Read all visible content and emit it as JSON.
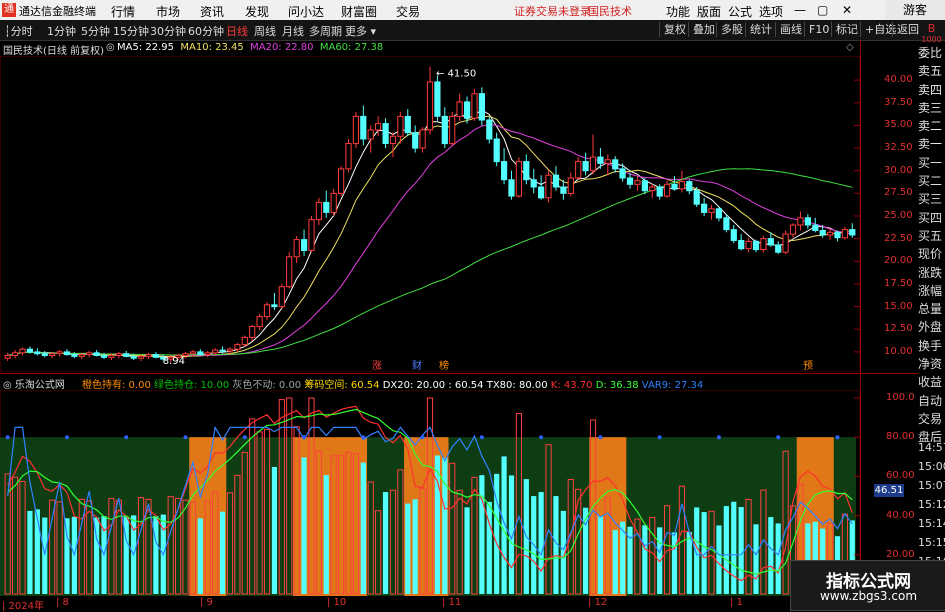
{
  "app": {
    "logo_glyph": "通",
    "name": "通达信金融终端",
    "menu": [
      "行情",
      "市场",
      "资讯",
      "发现",
      "问小达",
      "财富圈",
      "交易"
    ],
    "warning": "证券交易未登录",
    "stock_name": "国民技术",
    "right_menu": [
      "功能",
      "版面",
      "公式",
      "选项"
    ],
    "guest": "游客",
    "window_controls": [
      "—",
      "▢",
      "✕"
    ]
  },
  "toolbar": {
    "periods": [
      "分时",
      "1分钟",
      "5分钟",
      "15分钟",
      "30分钟",
      "60分钟",
      "日线",
      "周线",
      "月线",
      "多周期",
      "更多"
    ],
    "active_period": "日线",
    "buttons": [
      "复权",
      "叠加",
      "多股",
      "统计",
      "画线",
      "F10",
      "标记",
      "+自选",
      "返回"
    ]
  },
  "main_chart": {
    "title": "国民技术(日线 前复权)",
    "ma": [
      {
        "label": "MA5: 22.95",
        "color": "#ffffff"
      },
      {
        "label": "MA10: 23.45",
        "color": "#f0e060"
      },
      {
        "label": "MA20: 22.80",
        "color": "#e040e0"
      },
      {
        "label": "MA60: 27.38",
        "color": "#40e040"
      }
    ],
    "high_label": "41.50",
    "low_label": "8.94",
    "price_ticks": [
      "40.00",
      "37.50",
      "35.00",
      "32.50",
      "30.00",
      "27.50",
      "25.00",
      "22.50",
      "20.00",
      "17.50",
      "15.00",
      "12.50",
      "10.00"
    ],
    "markers": [
      {
        "text": "涨",
        "color": "#ff3030"
      },
      {
        "text": "财",
        "color": "#3060ff"
      },
      {
        "text": "榜",
        "color": "#ff8000"
      },
      {
        "text": "预",
        "color": "#ff8000"
      }
    ]
  },
  "indicator": {
    "name": "乐淘公式网",
    "params": [
      {
        "label": "橙色持有: 0.00",
        "color": "#ff8c00"
      },
      {
        "label": "绿色持仓: 10.00",
        "color": "#00c000"
      },
      {
        "label": "灰色不动: 0.00",
        "color": "#a0a0a0"
      },
      {
        "label": "筹码空间: 60.54",
        "color": "#ffd700"
      },
      {
        "label": "DX20: 20.00",
        "color": "#ffffff"
      },
      {
        "label": ": 60.54",
        "color": "#ffffff"
      },
      {
        "label": "TX80: 80.00",
        "color": "#ffffff"
      },
      {
        "label": "K: 43.70",
        "color": "#ff3030"
      },
      {
        "label": "D: 36.38",
        "color": "#30ff30"
      },
      {
        "label": "VAR9: 27.34",
        "color": "#3080ff"
      }
    ],
    "ticks": [
      "100.0",
      "80.00",
      "60.00",
      "40.00",
      "20.00"
    ],
    "current_value": "46.51"
  },
  "x_axis": {
    "labels": [
      "2024年",
      "8",
      "9",
      "10",
      "11",
      "12",
      "1"
    ]
  },
  "side_panel": {
    "items": [
      "委比",
      "卖五",
      "卖四",
      "卖三",
      "卖二",
      "卖一",
      "买一",
      "买二",
      "买三",
      "买四",
      "买五",
      "现价",
      "涨跌",
      "涨幅",
      "总量",
      "外盘",
      "换手",
      "净资",
      "收益",
      "自动",
      "交易",
      "盘后"
    ],
    "top_label": "B",
    "top_sub": "1000",
    "times": [
      "14:57",
      "15:00",
      "15:07",
      "15:12",
      "15:14",
      "15:15",
      "15:16",
      "15:17"
    ]
  },
  "watermark": {
    "line1": "指标公式网",
    "line2": "www.zbgs3.com"
  },
  "chart_data": {
    "type": "candlestick",
    "ylim": [
      8.0,
      42.0
    ],
    "ohlc": [
      [
        9.3,
        9.9,
        9.0,
        9.6
      ],
      [
        9.6,
        10.2,
        9.3,
        9.9
      ],
      [
        9.9,
        10.5,
        9.6,
        10.3
      ],
      [
        10.3,
        10.6,
        9.8,
        10.0
      ],
      [
        10.0,
        10.4,
        9.6,
        9.8
      ],
      [
        9.8,
        10.1,
        9.4,
        9.6
      ],
      [
        9.6,
        10.0,
        9.3,
        9.8
      ],
      [
        9.8,
        10.2,
        9.5,
        10.0
      ],
      [
        10.0,
        10.3,
        9.6,
        9.7
      ],
      [
        9.7,
        10.0,
        9.3,
        9.5
      ],
      [
        9.5,
        9.9,
        9.2,
        9.7
      ],
      [
        9.7,
        10.1,
        9.4,
        9.9
      ],
      [
        9.9,
        10.2,
        9.5,
        9.6
      ],
      [
        9.6,
        9.9,
        9.2,
        9.4
      ],
      [
        9.4,
        9.8,
        9.1,
        9.6
      ],
      [
        9.6,
        10.0,
        9.3,
        9.8
      ],
      [
        9.8,
        10.1,
        9.4,
        9.5
      ],
      [
        9.5,
        9.8,
        9.1,
        9.3
      ],
      [
        9.3,
        9.7,
        9.0,
        9.5
      ],
      [
        9.5,
        9.9,
        9.2,
        9.7
      ],
      [
        9.7,
        10.0,
        9.3,
        9.4
      ],
      [
        9.4,
        9.7,
        9.0,
        9.2
      ],
      [
        9.2,
        9.6,
        8.9,
        9.4
      ],
      [
        9.4,
        9.8,
        9.1,
        9.6
      ],
      [
        9.6,
        10.0,
        9.3,
        9.8
      ],
      [
        9.8,
        10.2,
        9.5,
        10.0
      ],
      [
        10.0,
        10.3,
        9.6,
        9.7
      ],
      [
        9.7,
        10.1,
        9.4,
        9.9
      ],
      [
        9.9,
        10.4,
        9.6,
        10.2
      ],
      [
        10.2,
        10.6,
        9.8,
        10.1
      ],
      [
        10.1,
        10.5,
        9.7,
        10.3
      ],
      [
        10.3,
        11.0,
        10.0,
        10.8
      ],
      [
        10.8,
        11.8,
        10.5,
        11.6
      ],
      [
        11.6,
        13.0,
        11.2,
        12.8
      ],
      [
        12.8,
        14.2,
        12.4,
        13.9
      ],
      [
        13.9,
        15.5,
        13.5,
        15.2
      ],
      [
        15.2,
        16.5,
        14.6,
        15.0
      ],
      [
        15.0,
        17.5,
        14.8,
        17.2
      ],
      [
        17.2,
        21.0,
        17.0,
        20.5
      ],
      [
        20.5,
        22.8,
        19.8,
        22.4
      ],
      [
        22.4,
        23.5,
        20.6,
        21.2
      ],
      [
        21.2,
        25.0,
        21.0,
        24.6
      ],
      [
        24.6,
        27.0,
        24.0,
        26.5
      ],
      [
        26.5,
        27.8,
        24.8,
        25.4
      ],
      [
        25.4,
        28.0,
        25.0,
        27.5
      ],
      [
        27.5,
        30.5,
        27.2,
        30.2
      ],
      [
        30.2,
        33.5,
        29.8,
        33.0
      ],
      [
        33.0,
        36.5,
        32.5,
        36.0
      ],
      [
        36.0,
        37.2,
        32.8,
        33.5
      ],
      [
        33.5,
        35.0,
        32.0,
        34.5
      ],
      [
        34.5,
        36.0,
        33.8,
        35.2
      ],
      [
        35.2,
        35.8,
        32.5,
        33.0
      ],
      [
        33.0,
        34.2,
        31.5,
        33.8
      ],
      [
        33.8,
        36.5,
        33.0,
        36.0
      ],
      [
        36.0,
        36.8,
        33.8,
        34.2
      ],
      [
        34.2,
        35.0,
        32.0,
        32.5
      ],
      [
        32.5,
        34.8,
        32.0,
        34.5
      ],
      [
        34.5,
        41.5,
        34.0,
        39.8
      ],
      [
        39.8,
        40.5,
        35.5,
        36.0
      ],
      [
        36.0,
        37.0,
        32.5,
        33.0
      ],
      [
        33.0,
        36.5,
        32.8,
        36.0
      ],
      [
        36.0,
        38.5,
        35.5,
        37.6
      ],
      [
        37.6,
        38.2,
        35.2,
        35.8
      ],
      [
        35.8,
        39.0,
        35.5,
        38.5
      ],
      [
        38.5,
        39.2,
        35.0,
        35.6
      ],
      [
        35.6,
        36.0,
        33.0,
        33.5
      ],
      [
        33.5,
        34.2,
        30.5,
        31.0
      ],
      [
        31.0,
        32.5,
        28.5,
        29.0
      ],
      [
        29.0,
        30.0,
        26.8,
        27.2
      ],
      [
        27.2,
        31.5,
        27.0,
        31.0
      ],
      [
        31.0,
        31.8,
        28.5,
        29.0
      ],
      [
        29.0,
        30.2,
        27.5,
        28.2
      ],
      [
        28.2,
        29.5,
        26.8,
        27.0
      ],
      [
        27.0,
        30.0,
        26.5,
        29.5
      ],
      [
        29.5,
        30.5,
        27.8,
        28.2
      ],
      [
        28.2,
        29.0,
        26.8,
        27.5
      ],
      [
        27.5,
        29.8,
        27.2,
        29.2
      ],
      [
        29.2,
        31.5,
        29.0,
        31.0
      ],
      [
        31.0,
        32.0,
        29.5,
        30.0
      ],
      [
        30.0,
        34.0,
        29.6,
        31.5
      ],
      [
        31.5,
        32.5,
        30.2,
        30.8
      ],
      [
        30.8,
        31.8,
        29.5,
        31.2
      ],
      [
        31.2,
        31.6,
        29.8,
        30.2
      ],
      [
        30.2,
        30.8,
        28.8,
        29.2
      ],
      [
        29.2,
        29.8,
        28.0,
        28.5
      ],
      [
        28.5,
        29.4,
        27.8,
        28.9
      ],
      [
        28.9,
        29.2,
        27.4,
        27.8
      ],
      [
        27.8,
        28.6,
        27.0,
        28.2
      ],
      [
        28.2,
        28.5,
        26.8,
        27.2
      ],
      [
        27.2,
        28.9,
        27.0,
        28.5
      ],
      [
        28.5,
        29.4,
        27.8,
        28.0
      ],
      [
        28.0,
        30.0,
        27.6,
        28.8
      ],
      [
        28.8,
        29.0,
        27.4,
        27.8
      ],
      [
        27.8,
        28.2,
        26.0,
        26.3
      ],
      [
        26.3,
        27.0,
        25.0,
        25.4
      ],
      [
        25.4,
        26.2,
        24.6,
        25.8
      ],
      [
        25.8,
        26.0,
        24.4,
        24.8
      ],
      [
        24.8,
        25.2,
        23.2,
        23.5
      ],
      [
        23.5,
        24.0,
        22.0,
        22.3
      ],
      [
        22.3,
        23.0,
        21.2,
        21.4
      ],
      [
        21.4,
        22.6,
        21.0,
        22.2
      ],
      [
        22.2,
        22.4,
        21.0,
        21.3
      ],
      [
        21.3,
        22.8,
        21.0,
        22.5
      ],
      [
        22.5,
        23.2,
        21.6,
        21.8
      ],
      [
        21.8,
        22.2,
        20.8,
        21.0
      ],
      [
        21.0,
        23.4,
        20.8,
        23.0
      ],
      [
        23.0,
        24.2,
        22.6,
        24.0
      ],
      [
        24.0,
        25.5,
        23.4,
        24.8
      ],
      [
        24.8,
        25.2,
        23.6,
        24.0
      ],
      [
        24.0,
        24.8,
        23.2,
        23.4
      ],
      [
        23.4,
        24.0,
        22.6,
        22.9
      ],
      [
        22.9,
        23.6,
        22.4,
        23.2
      ],
      [
        23.2,
        23.4,
        22.2,
        22.6
      ],
      [
        22.6,
        23.8,
        22.4,
        23.5
      ],
      [
        23.5,
        24.2,
        22.6,
        22.9
      ]
    ],
    "indicator_series": [
      {
        "name": "K",
        "color": "#ff3030"
      },
      {
        "name": "D",
        "color": "#30ff30"
      },
      {
        "name": "VAR9",
        "color": "#3080ff"
      }
    ]
  }
}
